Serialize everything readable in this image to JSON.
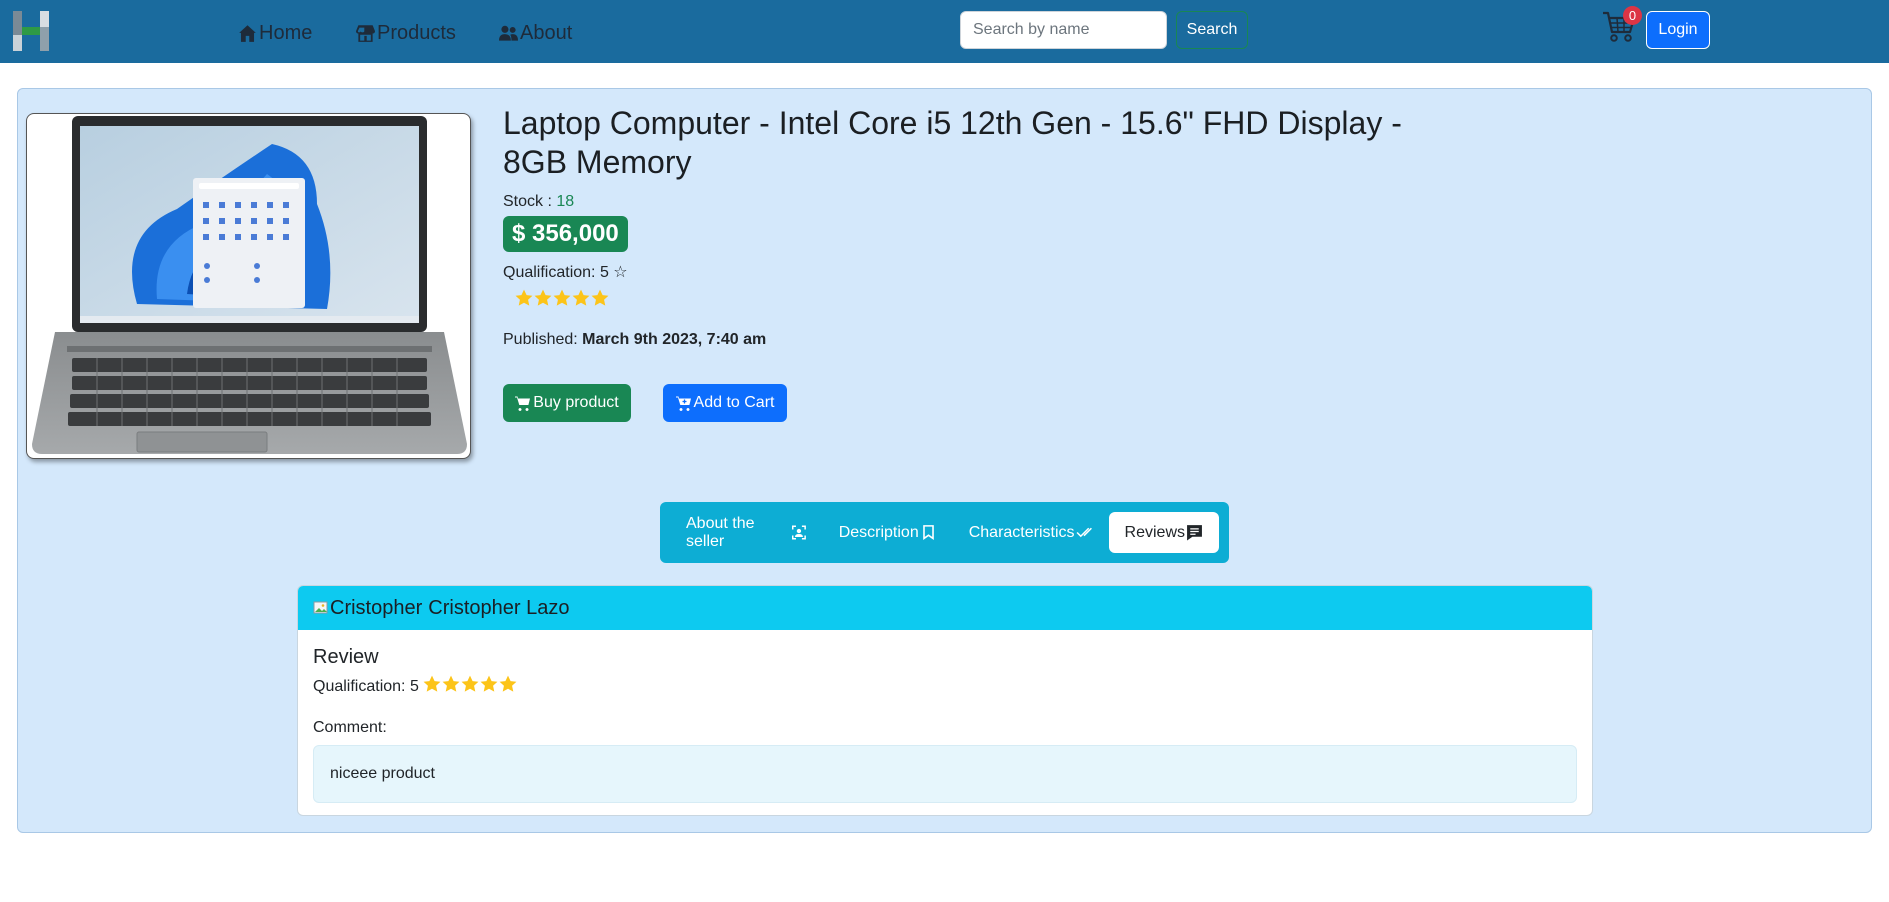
{
  "nav": {
    "home": "Home",
    "products": "Products",
    "about": "About",
    "search_placeholder": "Search by name",
    "search_button": "Search",
    "cart_count": "0",
    "login": "Login"
  },
  "product": {
    "title": "Laptop Computer - Intel Core i5 12th Gen - 15.6\" FHD Display - 8GB Memory",
    "stock_label": "Stock : ",
    "stock_value": "18",
    "price": "$ 356,000",
    "qualification_label": "Qualification: 5 ☆",
    "rating": 5,
    "published_label": "Published: ",
    "published_date": "March 9th 2023, 7:40 am",
    "buy_label": "Buy product",
    "add_cart_label": "Add to Cart"
  },
  "tabs": [
    {
      "label": "About the seller",
      "icon": "person-badge-icon"
    },
    {
      "label": "Description",
      "icon": "bookmark-icon"
    },
    {
      "label": "Characteristics",
      "icon": "check-all-icon"
    },
    {
      "label": "Reviews",
      "icon": "chat-square-text-icon"
    }
  ],
  "review": {
    "avatar_alt": "Cristopher",
    "reviewer": "Cristopher Lazo",
    "title": "Review",
    "qualification_label": "Qualification: 5",
    "rating": 5,
    "comment_label": "Comment:",
    "comment": "niceee product"
  },
  "colors": {
    "navbar": "#1a6b9e",
    "card_bg": "#d4e8fb",
    "success": "#198754",
    "primary": "#0d6efd",
    "tabs_bg": "#0dadd4",
    "review_header": "#0dcaf0",
    "star": "#fcc419"
  }
}
